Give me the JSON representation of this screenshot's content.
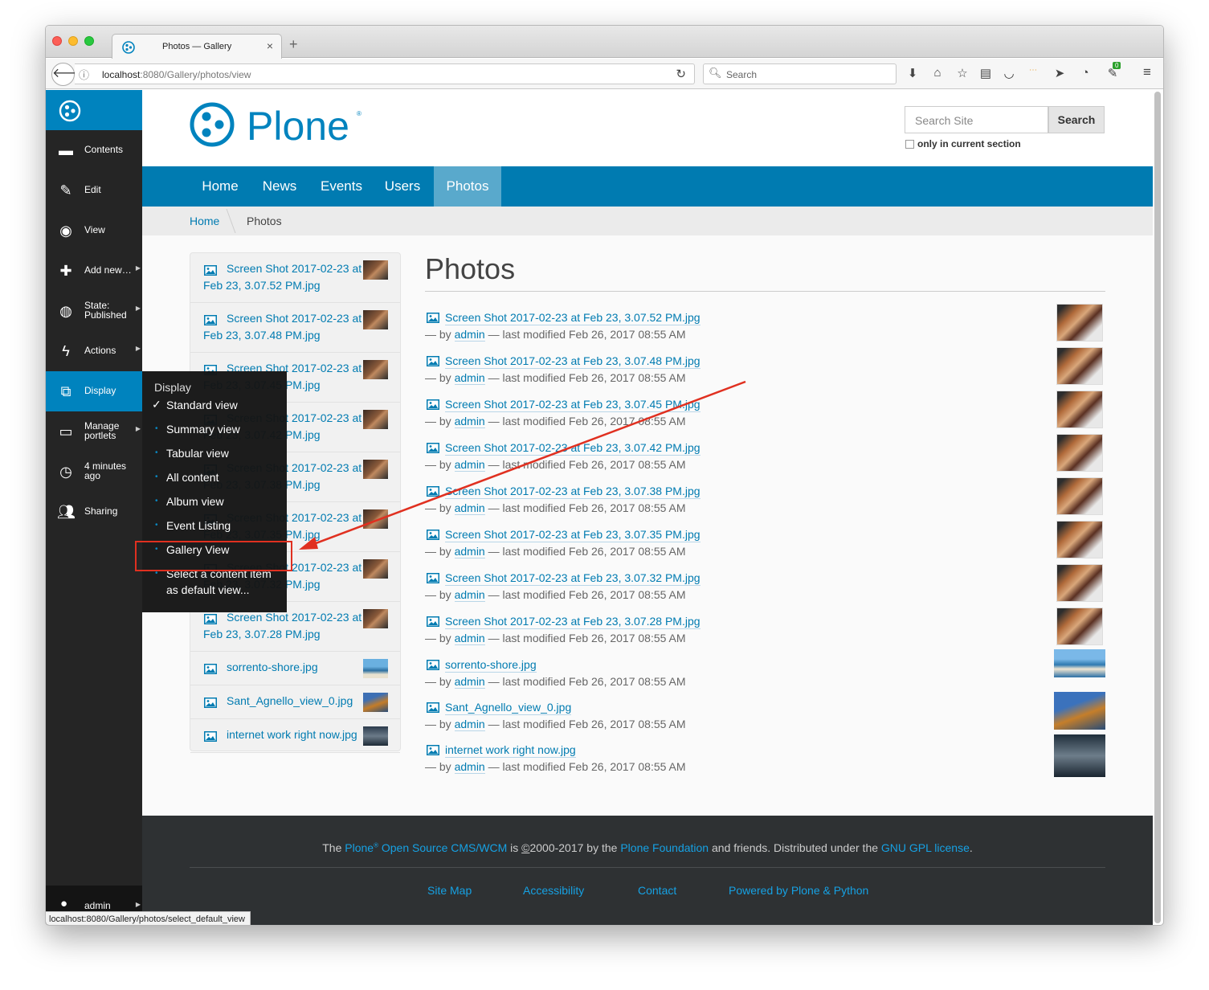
{
  "browser": {
    "tab_title": "Photos — Gallery",
    "url_host": "localhost",
    "url_path": ":8080/Gallery/photos/view",
    "search_placeholder": "Search",
    "badge": "0",
    "status_url": "localhost:8080/Gallery/photos/select_default_view"
  },
  "toolbar": {
    "items": [
      {
        "label": "Contents",
        "icon": "folder-icon"
      },
      {
        "label": "Edit",
        "icon": "pencil-icon"
      },
      {
        "label": "View",
        "icon": "eye-icon"
      },
      {
        "label": "Add new…",
        "icon": "plus-icon"
      },
      {
        "label": "State:",
        "label2": "Published",
        "icon": "state-icon"
      },
      {
        "label": "Actions",
        "icon": "bolt-icon"
      },
      {
        "label": "Display",
        "icon": "display-icon"
      },
      {
        "label": "Manage",
        "label2": "portlets",
        "icon": "portlets-icon"
      },
      {
        "label": "4 minutes",
        "label2": "ago",
        "icon": "clock-icon"
      },
      {
        "label": "Sharing",
        "icon": "users-icon"
      }
    ],
    "user": "admin"
  },
  "display_menu": {
    "heading": "Display",
    "checkmark": "✓",
    "items": [
      "Standard view",
      "Summary view",
      "Tabular view",
      "All content",
      "Album view",
      "Event Listing",
      "Gallery View",
      "Select a content item",
      "as default view..."
    ]
  },
  "header": {
    "logo_text": "Plone",
    "search_placeholder": "Search Site",
    "search_button": "Search",
    "only_section": "only in current section"
  },
  "nav": [
    "Home",
    "News",
    "Events",
    "Users",
    "Photos"
  ],
  "breadcrumbs": [
    "Home",
    "Photos"
  ],
  "portlet": [
    {
      "l1": "Screen Shot 2017-02-23 at",
      "l2": "Feb 23, 3.07.52 PM.jpg"
    },
    {
      "l1": "Screen Shot 2017-02-23 at",
      "l2": "Feb 23, 3.07.48 PM.jpg"
    },
    {
      "l1": "Screen Shot 2017-02-23 at",
      "l2": "Feb 23, 3.07.45 PM.jpg"
    },
    {
      "l1": "Screen Shot 2017-02-23 at",
      "l2": "Feb 23, 3.07.42 PM.jpg"
    },
    {
      "l1": "Screen Shot 2017-02-23 at",
      "l2": "Feb 23, 3.07.38 PM.jpg"
    },
    {
      "l1": "Screen Shot 2017-02-23 at",
      "l2": "Feb 23, 3.07.35 PM.jpg"
    },
    {
      "l1": "Screen Shot 2017-02-23 at",
      "l2": "Feb 23, 3.07.32 PM.jpg"
    },
    {
      "l1": "Screen Shot 2017-02-23 at",
      "l2": "Feb 23, 3.07.28 PM.jpg"
    },
    {
      "l1": "sorrento-shore.jpg",
      "l2": ""
    },
    {
      "l1": "Sant_Agnello_view_0.jpg",
      "l2": ""
    },
    {
      "l1": "internet work right now.jpg",
      "l2": ""
    }
  ],
  "content": {
    "title": "Photos",
    "by": "— by",
    "author": "admin",
    "modified": "— last modified Feb 26, 2017 08:55 AM",
    "items": [
      "Screen Shot 2017-02-23 at Feb 23, 3.07.52 PM.jpg",
      "Screen Shot 2017-02-23 at Feb 23, 3.07.48 PM.jpg",
      "Screen Shot 2017-02-23 at Feb 23, 3.07.45 PM.jpg",
      "Screen Shot 2017-02-23 at Feb 23, 3.07.42 PM.jpg",
      "Screen Shot 2017-02-23 at Feb 23, 3.07.38 PM.jpg",
      "Screen Shot 2017-02-23 at Feb 23, 3.07.35 PM.jpg",
      "Screen Shot 2017-02-23 at Feb 23, 3.07.32 PM.jpg",
      "Screen Shot 2017-02-23 at Feb 23, 3.07.28 PM.jpg",
      "sorrento-shore.jpg",
      "Sant_Agnello_view_0.jpg",
      "internet work right now.jpg"
    ]
  },
  "footer": {
    "the": "The",
    "plone": "Plone",
    "reg": "®",
    "cms": "Open Source CMS/WCM",
    "is": "is",
    "copy": "©",
    "years": "2000-2017 by the",
    "foundation": "Plone Foundation",
    "and": "and friends. Distributed under the",
    "license": "GNU GPL license",
    "dot": ".",
    "links": [
      "Site Map",
      "Accessibility",
      "Contact",
      "Powered by Plone & Python"
    ]
  },
  "colors": {
    "plone_blue": "#007bb1",
    "toolbar_dark": "#252525",
    "annotation_red": "#e03020"
  }
}
